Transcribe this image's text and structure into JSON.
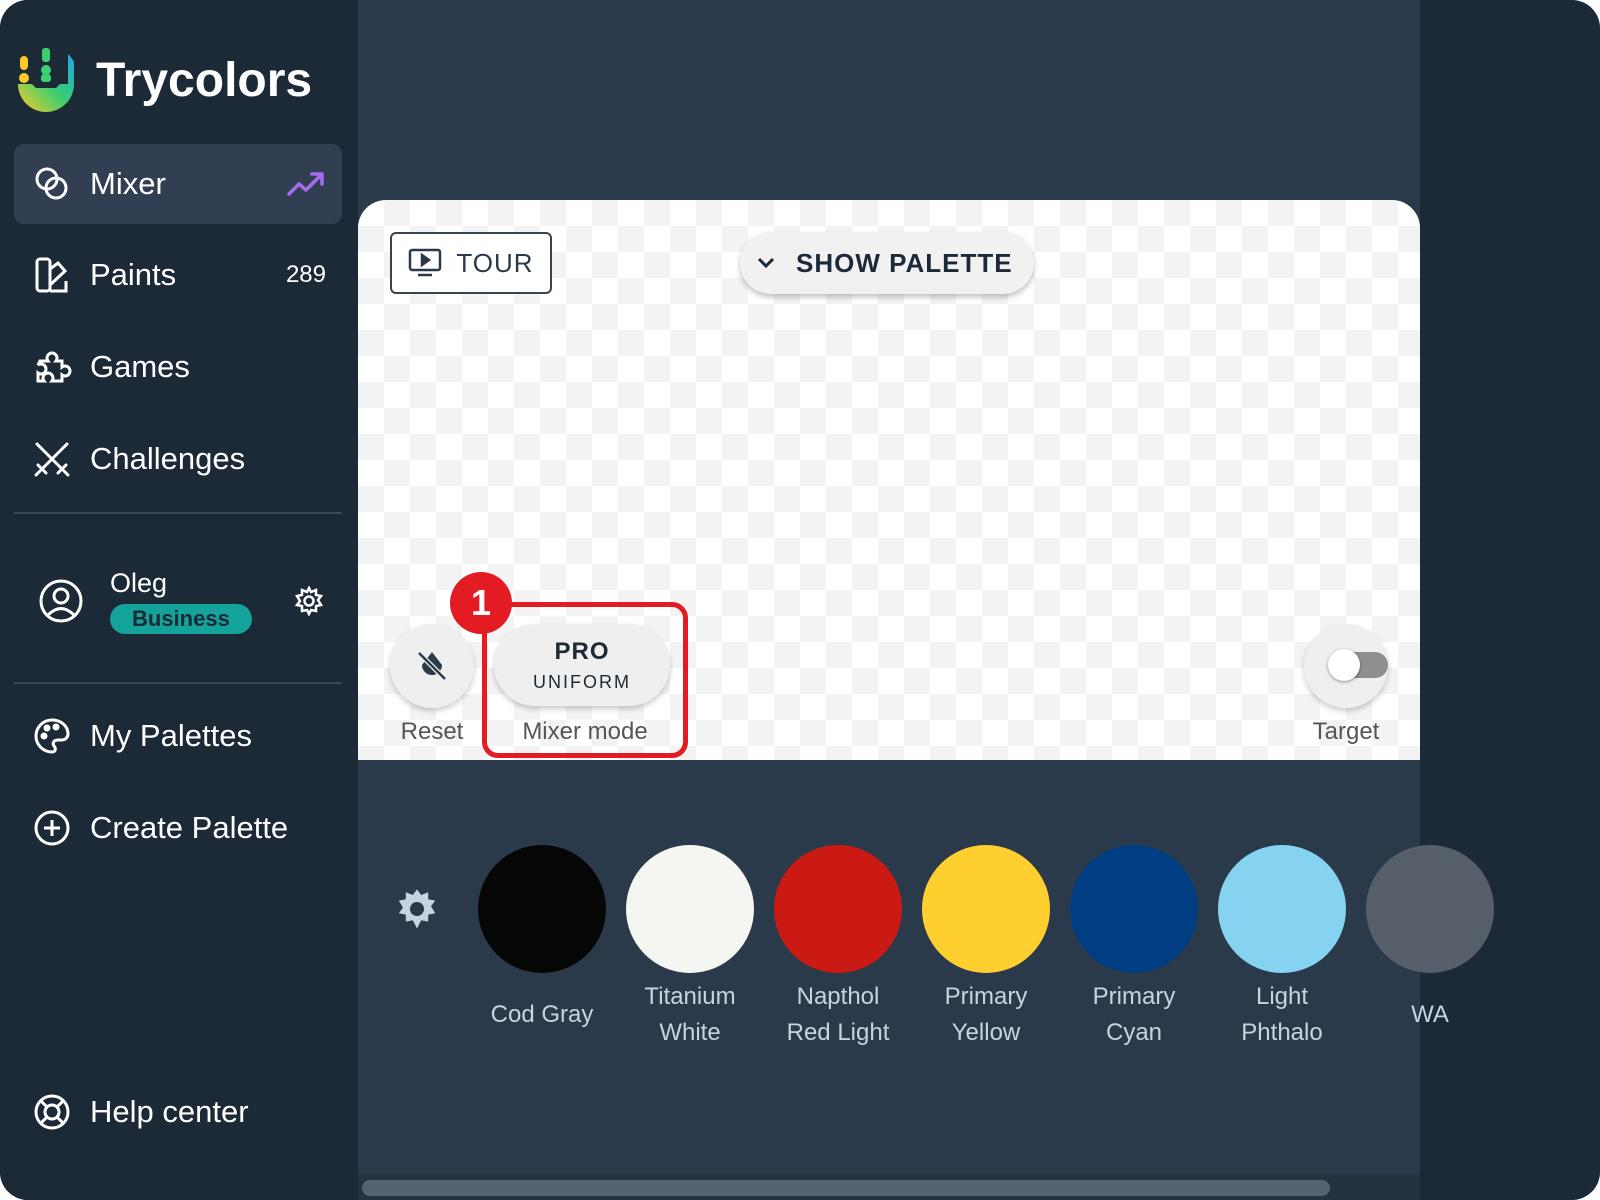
{
  "app": {
    "name": "Trycolors"
  },
  "sidebar": {
    "items": [
      {
        "label": "Mixer",
        "icon": "circles-icon",
        "badge_icon": "trending-up-icon",
        "active": true
      },
      {
        "label": "Paints",
        "icon": "paints-icon",
        "count": "289"
      },
      {
        "label": "Games",
        "icon": "puzzle-icon"
      },
      {
        "label": "Challenges",
        "icon": "swords-icon"
      }
    ],
    "user": {
      "name": "Oleg",
      "plan": "Business"
    },
    "palettes": [
      {
        "label": "My Palettes",
        "icon": "palette-icon"
      },
      {
        "label": "Create Palette",
        "icon": "plus-circle-icon"
      }
    ],
    "help": {
      "label": "Help center",
      "icon": "lifebuoy-icon"
    }
  },
  "canvas": {
    "tour_label": "TOUR",
    "show_palette_label": "SHOW PALETTE",
    "reset_label": "Reset",
    "mode_top": "PRO",
    "mode_bottom": "UNIFORM",
    "mode_label": "Mixer mode",
    "target_label": "Target",
    "target_on": false,
    "callout_number": "1"
  },
  "colors": {
    "accent": "#e31b23",
    "badge": "#14a39a",
    "trend": "#a66cf0"
  },
  "swatches": [
    {
      "name": "Cod Gray",
      "color": "#070606"
    },
    {
      "name": "Titanium White",
      "color": "#f5f6f1"
    },
    {
      "name": "Napthol Red Light",
      "color": "#cb1914"
    },
    {
      "name": "Primary Yellow",
      "color": "#ffcf2f"
    },
    {
      "name": "Primary Cyan",
      "color": "#003e84"
    },
    {
      "name": "Light Phthalo",
      "color": "#85d3f1"
    },
    {
      "name": "WA",
      "color": "#565f69"
    }
  ]
}
